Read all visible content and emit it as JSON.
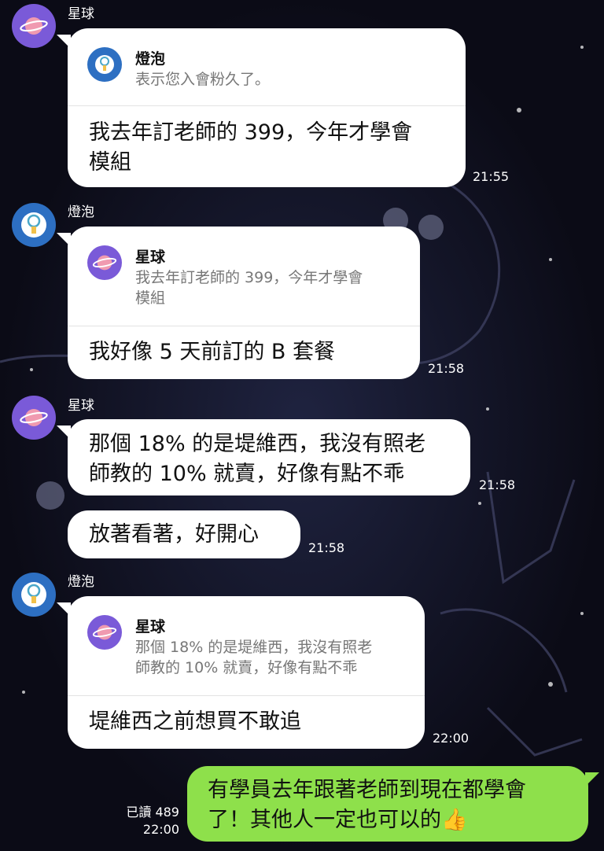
{
  "contacts": {
    "planet": "星球",
    "bulb": "燈泡"
  },
  "messages": [
    {
      "sender": "星球",
      "quote_name": "燈泡",
      "quote_text": "表示您入會粉久了。",
      "text_line1": "我去年訂老師的 399，今年才學會",
      "text_line2": "模組",
      "time": "21:55"
    },
    {
      "sender": "燈泡",
      "quote_name": "星球",
      "quote_text_line1": "我去年訂老師的 399，今年才學會",
      "quote_text_line2": "模組",
      "text": "我好像 5 天前訂的 B 套餐",
      "time": "21:58"
    },
    {
      "sender": "星球",
      "text_line1": "那個 18% 的是堤維西，我沒有照老",
      "text_line2": "師教的 10% 就賣，好像有點不乖",
      "time": "21:58"
    },
    {
      "text": "放著看著，好開心",
      "time": "21:58"
    },
    {
      "sender": "燈泡",
      "quote_name": "星球",
      "quote_text_line1": "那個 18% 的是堤維西，我沒有照老",
      "quote_text_line2": "師教的 10% 就賣，好像有點不乖",
      "text": "堤維西之前想買不敢追",
      "time": "22:00"
    },
    {
      "outgoing": true,
      "text_line1": "有學員去年跟著老師到現在都學會",
      "text_line2": "了！其他人一定也可以的",
      "emoji": "👍",
      "read_label": "已讀 489",
      "time": "22:00"
    }
  ],
  "colors": {
    "background": "#0b0b16",
    "bubble_in": "#ffffff",
    "bubble_out": "#8ee04b",
    "avatar_planet": "#7a5ad8",
    "avatar_bulb": "#2d6fc2"
  }
}
